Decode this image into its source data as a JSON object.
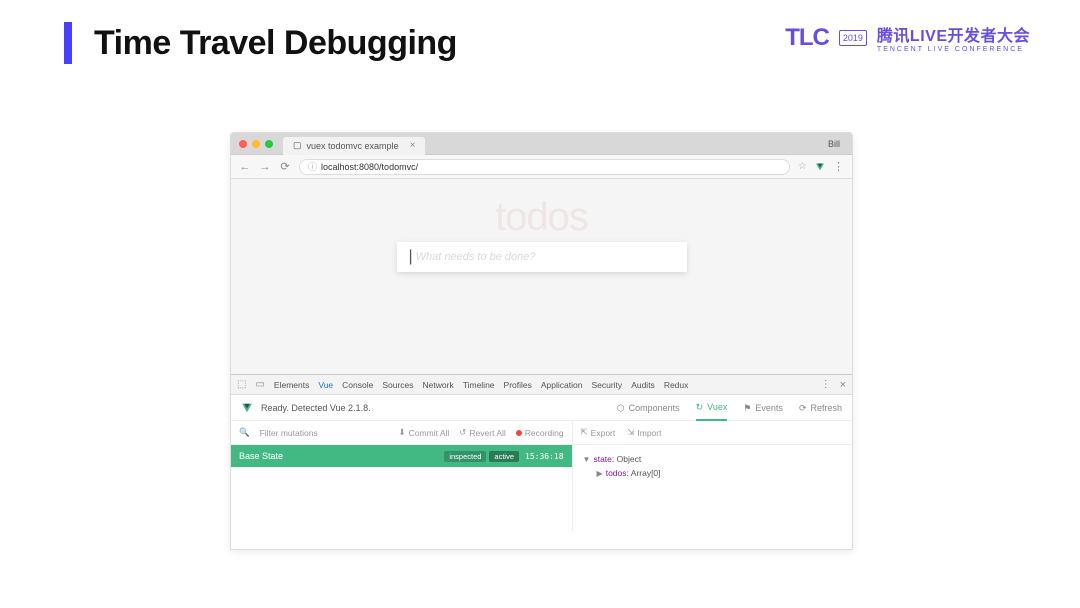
{
  "slide": {
    "title": "Time Travel Debugging",
    "logo_text": "TLC",
    "logo_year": "2019",
    "logo_cn": "腾讯LIVE开发者大会",
    "logo_en": "TENCENT LIVE CONFERENCE"
  },
  "browser": {
    "tab_title": "vuex todomvc example",
    "tab_user": "Bill",
    "url": "localhost:8080/todomvc/",
    "page": {
      "heading": "todos",
      "placeholder": "What needs to be done?"
    }
  },
  "devtools": {
    "tabs": [
      "Elements",
      "Vue",
      "Console",
      "Sources",
      "Network",
      "Timeline",
      "Profiles",
      "Application",
      "Security",
      "Audits",
      "Redux"
    ],
    "active_tab": "Vue",
    "status": "Ready. Detected Vue 2.1.8.",
    "nav": {
      "components": "Components",
      "vuex": "Vuex",
      "events": "Events",
      "refresh": "Refresh"
    },
    "vuex": {
      "filter_placeholder": "Filter mutations",
      "commit_all": "Commit All",
      "revert_all": "Revert All",
      "recording": "Recording",
      "export": "Export",
      "import": "Import",
      "base_state": "Base State",
      "badge_inspected": "inspected",
      "badge_active": "active",
      "timestamp": "15:36:18",
      "state": {
        "line1_key": "state:",
        "line1_val": "Object",
        "line2_key": "todos:",
        "line2_val": "Array[0]"
      }
    }
  }
}
